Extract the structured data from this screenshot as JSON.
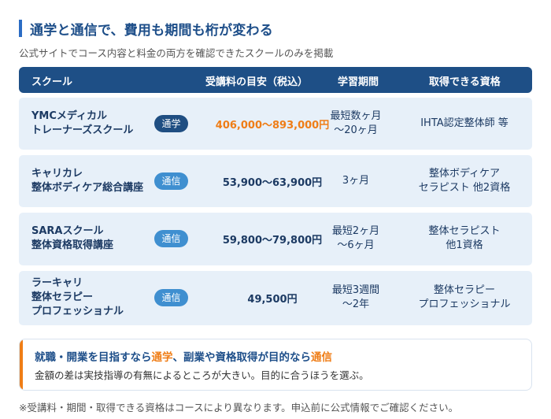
{
  "title": "通学と通信で、費用も期間も桁が変わる",
  "subtitle": "公式サイトでコース内容と料金の両方を確認できたスクールのみを掲載",
  "table": {
    "headers": {
      "school": "スクール",
      "price": "受講料の目安（税込）",
      "period": "学習期間",
      "qualification": "取得できる資格"
    },
    "rows": [
      {
        "name": [
          "YMCメディカル",
          "トレーナーズスクール"
        ],
        "type": "通学",
        "price": "406,000〜893,000円",
        "period": [
          "最短数ヶ月",
          "〜20ヶ月"
        ],
        "qualification": [
          "IHTA認定整体師 等"
        ]
      },
      {
        "name": [
          "キャリカレ",
          "整体ボディケア総合講座"
        ],
        "type": "通信",
        "price": "53,900〜63,900円",
        "period": [
          "3ヶ月"
        ],
        "qualification": [
          "整体ボディケア",
          "セラピスト 他2資格"
        ]
      },
      {
        "name": [
          "SARAスクール",
          "整体資格取得講座"
        ],
        "type": "通信",
        "price": "59,800〜79,800円",
        "period": [
          "最短2ヶ月",
          "〜6ヶ月"
        ],
        "qualification": [
          "整体セラピスト",
          "他1資格"
        ]
      },
      {
        "name": [
          "ラーキャリ",
          "整体セラピー",
          "プロフェッショナル"
        ],
        "type": "通信",
        "price": "49,500円",
        "period": [
          "最短3週間",
          "〜2年"
        ],
        "qualification": [
          "整体セラピー",
          "プロフェッショナル"
        ]
      }
    ]
  },
  "note": {
    "head_part1": "就職・開業を目指すなら",
    "head_kw1": "通学",
    "head_part2": "、副業や資格取得が目的なら",
    "head_kw2": "通信",
    "body": "金額の差は実技指導の有無によるところが大きい。目的に合うほうを選ぶ。"
  },
  "footnote": "※受講料・期間・取得できる資格はコースにより異なります。申込前に公式情報でご確認ください。",
  "colors": {
    "accent_blue": "#1e4f86",
    "highlight_orange": "#ef7d16",
    "row_bg": "#e7f0f9"
  }
}
